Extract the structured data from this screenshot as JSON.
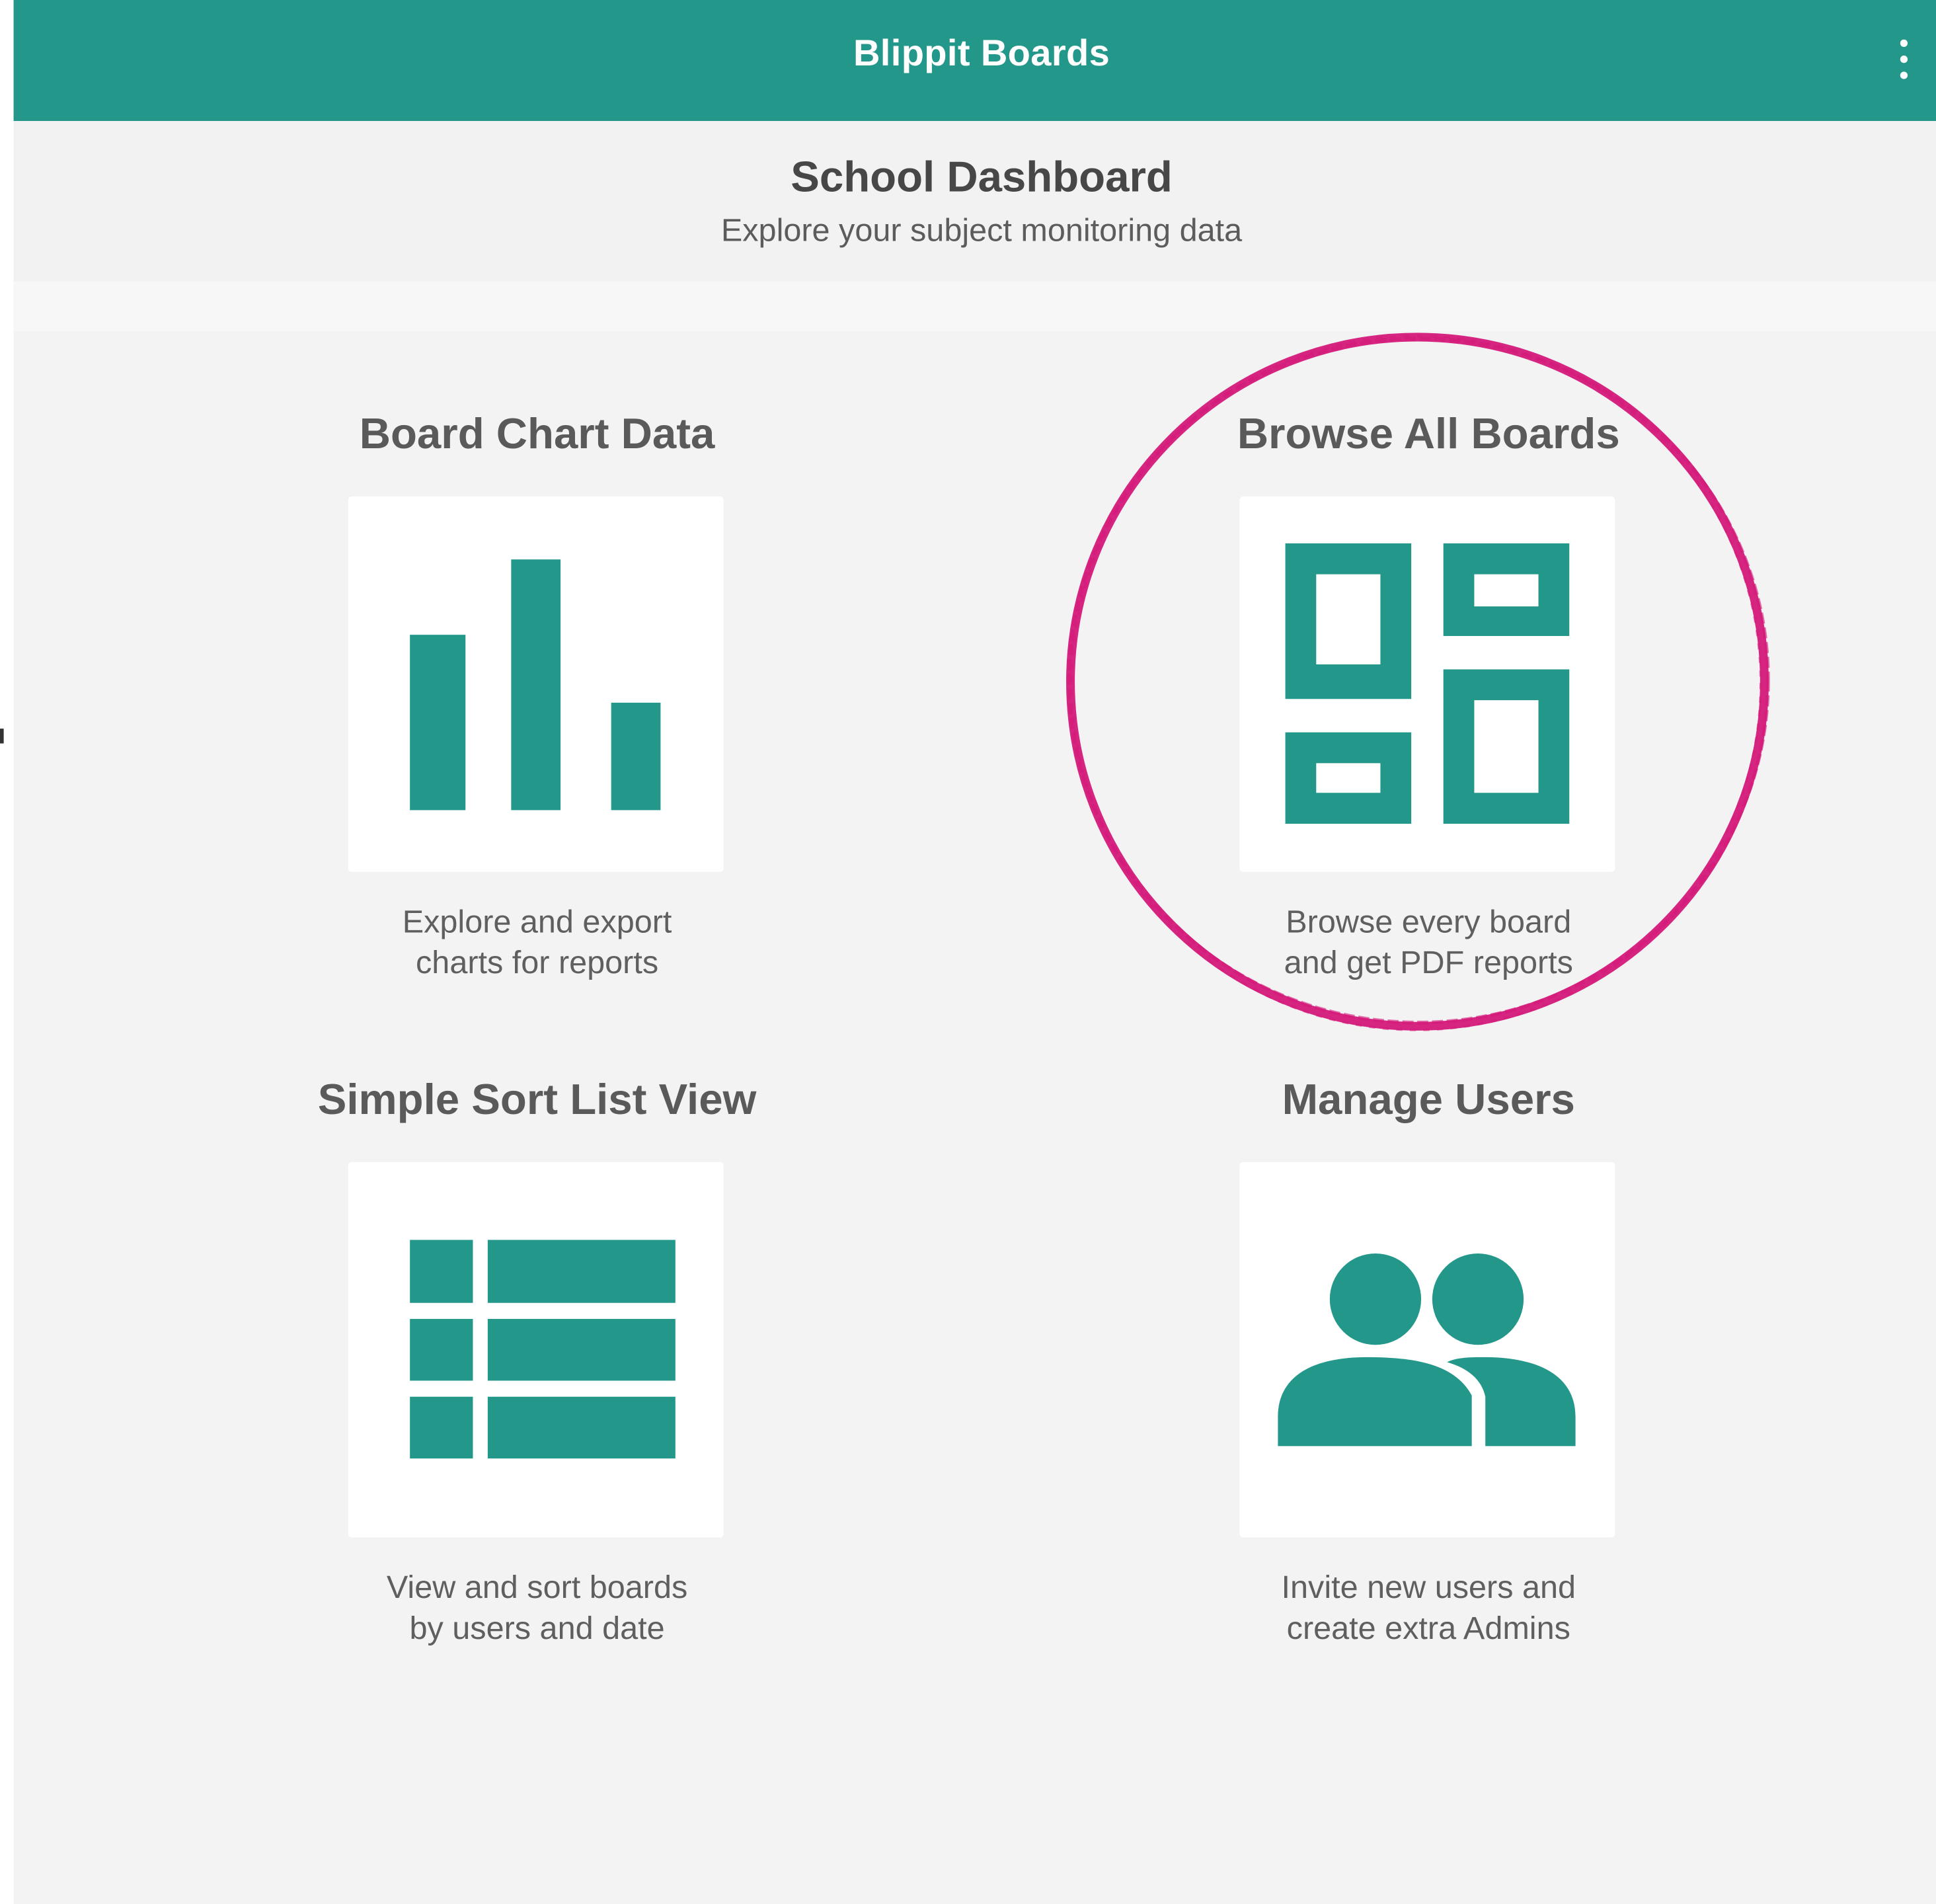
{
  "app": {
    "title": "Blippit Boards",
    "menu_icon": "more-vert-icon",
    "brand_color": "#23988a"
  },
  "header": {
    "title": "School Dashboard",
    "subtitle": "Explore your subject monitoring data"
  },
  "cards": [
    {
      "title": "Board Chart Data",
      "icon": "bar-chart-icon",
      "desc_line1": "Explore and export",
      "desc_line2": "charts for reports"
    },
    {
      "title": "Browse All Boards",
      "icon": "dashboard-grid-icon",
      "desc_line1": "Browse every board",
      "desc_line2": "and get PDF reports",
      "highlighted": true,
      "highlight_color": "#d4197a"
    },
    {
      "title": "Simple Sort List View",
      "icon": "list-view-icon",
      "desc_line1": "View and sort boards",
      "desc_line2": "by users and date"
    },
    {
      "title": "Manage Users",
      "icon": "users-icon",
      "desc_line1": "Invite new users and",
      "desc_line2": "create extra Admins"
    }
  ]
}
